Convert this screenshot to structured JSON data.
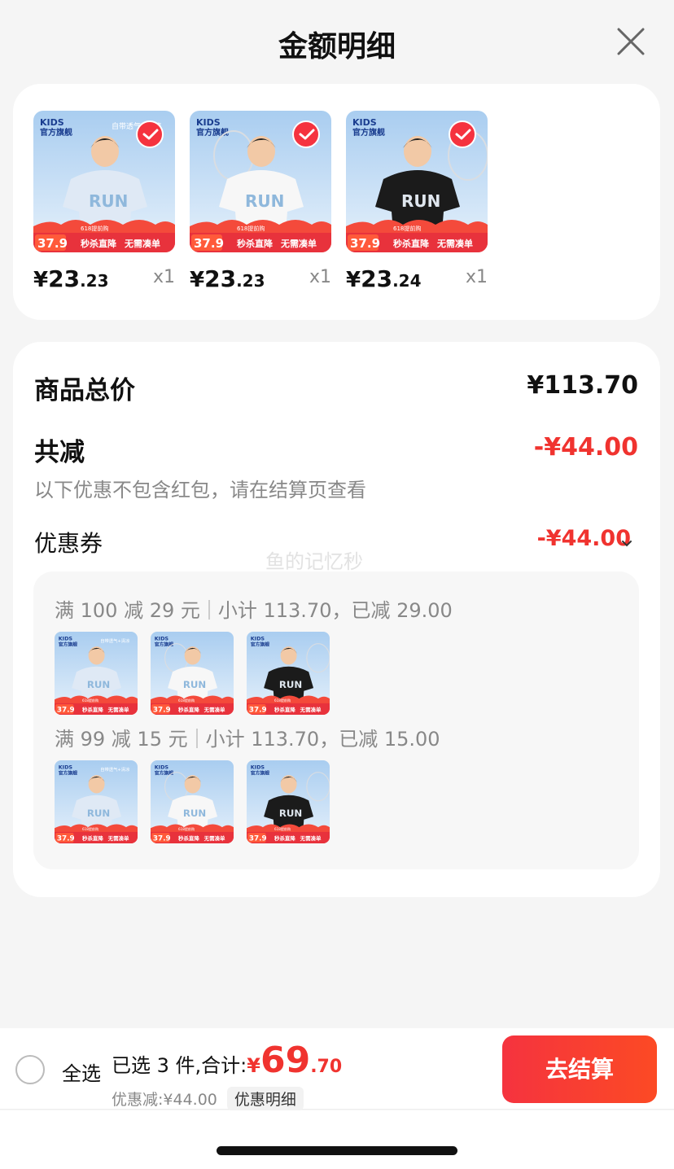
{
  "header": {
    "title": "金额明细"
  },
  "products": [
    {
      "shirt": "light",
      "color": "#dfe9f5",
      "price_yen": "¥",
      "price_int": "23",
      "price_dec": ".23",
      "qty": "x1"
    },
    {
      "shirt": "white",
      "color": "#f7f7f7",
      "price_yen": "¥",
      "price_int": "23",
      "price_dec": ".23",
      "qty": "x1"
    },
    {
      "shirt": "black",
      "color": "#1b1b1b",
      "price_yen": "¥",
      "price_int": "23",
      "price_dec": ".24",
      "qty": "x1"
    }
  ],
  "thumb_text": {
    "brand": "KIDS",
    "store": "官方旗舰",
    "shirt_print": "RUN",
    "promo_price": "37.9",
    "promo_a": "秒杀直降",
    "promo_b": "无需凑单",
    "banner_light": "自带透气+清凉",
    "banner_preheat": "618提前购"
  },
  "summary": {
    "total_label": "商品总价",
    "total_value": "¥113.70",
    "reduce_label": "共减",
    "reduce_value": "-¥44.00",
    "note": "以下优惠不包含红包，请在结算页查看",
    "coupon_label": "优惠券",
    "coupon_value": "-¥44.00",
    "watermark": "鱼的记忆秒"
  },
  "coupons": [
    {
      "rule": "满 100 减 29 元",
      "detail": "小计 113.70，已减 29.00"
    },
    {
      "rule": "满 99 减 15 元",
      "detail": "小计 113.70，已减 15.00"
    }
  ],
  "footer": {
    "select_all": "全选",
    "selected_text": "已选 3 件,合计:",
    "total_yen": "¥",
    "total_int": "69",
    "total_dec": ".70",
    "discount_text": "优惠减:¥44.00",
    "detail_label": "优惠明细",
    "checkout_label": "去结算"
  },
  "colors": {
    "accent": "#f0332f",
    "button": "#f5333f"
  }
}
